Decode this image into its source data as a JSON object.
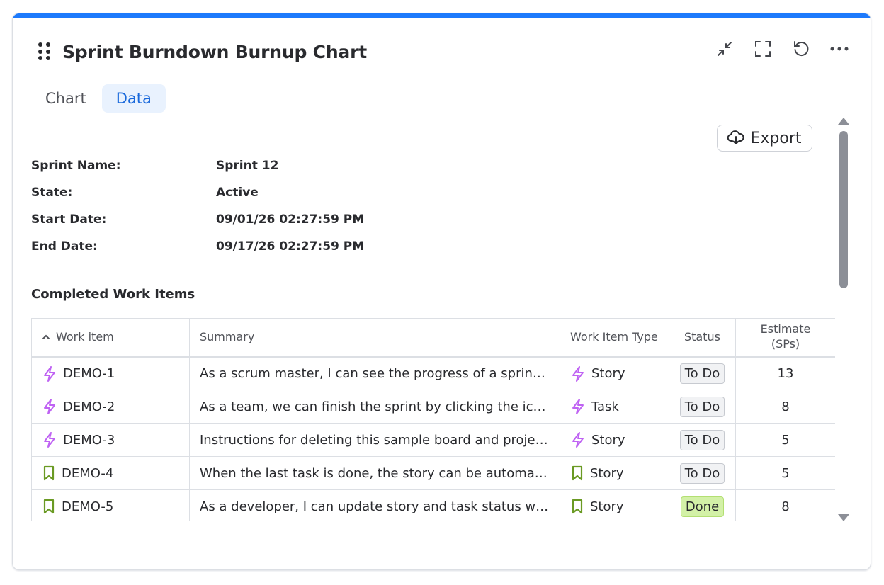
{
  "header": {
    "title": "Sprint Burndown Burnup Chart"
  },
  "tabs": [
    {
      "label": "Chart",
      "active": false
    },
    {
      "label": "Data",
      "active": true
    }
  ],
  "toolbar": {
    "export_label": "Export"
  },
  "sprint": {
    "fields": [
      {
        "label": "Sprint Name:",
        "value": "Sprint 12"
      },
      {
        "label": "State:",
        "value": "Active"
      },
      {
        "label": "Start Date:",
        "value": "09/01/26 02:27:59 PM"
      },
      {
        "label": "End Date:",
        "value": "09/17/26 02:27:59 PM"
      }
    ]
  },
  "section": {
    "title": "Completed Work Items"
  },
  "table": {
    "columns": [
      "Work item",
      "Summary",
      "Work Item Type",
      "Status",
      "Estimate (SPs)"
    ],
    "rows": [
      {
        "key": "DEMO-1",
        "icon": "lightning-icon",
        "summary": "As a scrum master, I can see the progress of a sprint...",
        "type": "Story",
        "type_icon": "lightning-icon",
        "status": "To Do",
        "estimate": "13"
      },
      {
        "key": "DEMO-2",
        "icon": "lightning-icon",
        "summary": "As a team, we can finish the sprint by clicking the icon ...",
        "type": "Task",
        "type_icon": "lightning-icon",
        "status": "To Do",
        "estimate": "8"
      },
      {
        "key": "DEMO-3",
        "icon": "lightning-icon",
        "summary": "Instructions for deleting this sample board and project...",
        "type": "Story",
        "type_icon": "lightning-icon",
        "status": "To Do",
        "estimate": "5"
      },
      {
        "key": "DEMO-4",
        "icon": "bookmark-icon",
        "summary": "When the last task is done, the story can be automatic...",
        "type": "Story",
        "type_icon": "bookmark-icon",
        "status": "To Do",
        "estimate": "5"
      },
      {
        "key": "DEMO-5",
        "icon": "bookmark-icon",
        "summary": "As a developer, I can update story and task status with ...",
        "type": "Story",
        "type_icon": "bookmark-icon",
        "status": "Done",
        "estimate": "8"
      }
    ]
  },
  "colors": {
    "accent": "#1d7afc",
    "lightning": "#bf63f3",
    "bookmark": "#6a9a23",
    "done_bg": "#d3f1a7"
  }
}
